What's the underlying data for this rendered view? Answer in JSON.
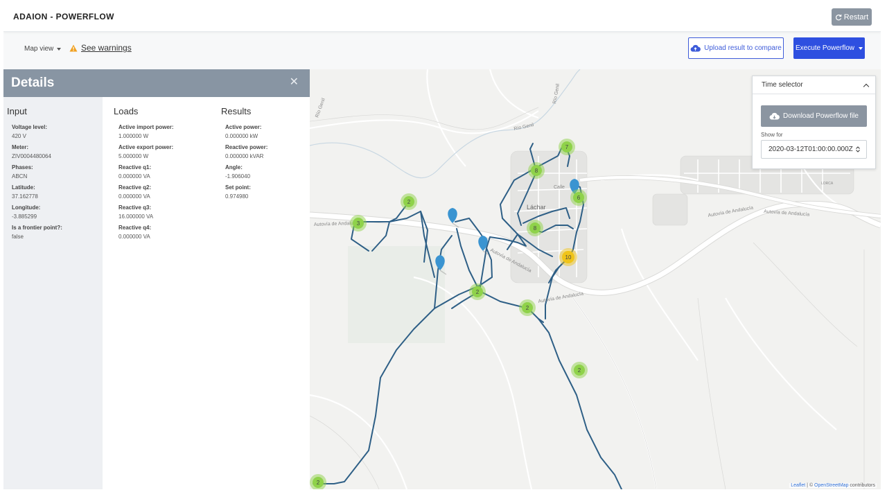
{
  "app": {
    "title": "ADAION - POWERFLOW",
    "restart_label": "Restart"
  },
  "toolbar": {
    "map_view_label": "Map view",
    "warnings_label": "See warnings",
    "upload_label": "Upload result to compare",
    "execute_label": "Execute Powerflow"
  },
  "details": {
    "title": "Details",
    "close_glyph": "✕",
    "input": {
      "heading": "Input",
      "fields": [
        {
          "label": "Voltage level:",
          "value": "420 V"
        },
        {
          "label": "Meter:",
          "value": "ZIV0004480064"
        },
        {
          "label": "Phases:",
          "value": "ABCN"
        },
        {
          "label": "Latitude:",
          "value": "37.162778"
        },
        {
          "label": "Longitude:",
          "value": "-3.885299"
        },
        {
          "label": "Is a frontier point?:",
          "value": "false"
        }
      ]
    },
    "loads": {
      "heading": "Loads",
      "fields": [
        {
          "label": "Active import power:",
          "value": "1.000000 W"
        },
        {
          "label": "Active export power:",
          "value": "5.000000 W"
        },
        {
          "label": "Reactive q1:",
          "value": "0.000000 VA"
        },
        {
          "label": "Reactive q2:",
          "value": "0.000000 VA"
        },
        {
          "label": "Reactive q3:",
          "value": "16.000000 VA"
        },
        {
          "label": "Reactive q4:",
          "value": "0.000000 VA"
        }
      ]
    },
    "results": {
      "heading": "Results",
      "fields": [
        {
          "label": "Active power:",
          "value": "0.000000 kW"
        },
        {
          "label": "Reactive power:",
          "value": "0.000000 kVAR"
        },
        {
          "label": "Angle:",
          "value": "-1.906040"
        },
        {
          "label": "Set point:",
          "value": "0.974980"
        }
      ]
    }
  },
  "time_selector": {
    "title": "Time selector",
    "download_label": "Download Powerflow file",
    "show_for_label": "Show for",
    "selected_time": "2020-03-12T01:00:00.000Z"
  },
  "map": {
    "town_label": "Láchar",
    "road_labels": [
      "Autovía de Andalucía",
      "Autovía de Andalucía",
      "Autovía de Andalucía",
      "Autovía de Andalucía",
      "Autovía de Andalucía"
    ],
    "river_labels": [
      "Río Genil",
      "Río Genil",
      "Río Genil"
    ],
    "street_label": "Calle",
    "lorca_label": "LORCA",
    "clusters": [
      {
        "count": "7",
        "color": "green"
      },
      {
        "count": "8",
        "color": "green"
      },
      {
        "count": "6",
        "color": "green"
      },
      {
        "count": "8",
        "color": "green"
      },
      {
        "count": "2",
        "color": "green"
      },
      {
        "count": "3",
        "color": "green"
      },
      {
        "count": "10",
        "color": "yellow"
      },
      {
        "count": "2",
        "color": "green"
      },
      {
        "count": "2",
        "color": "green"
      },
      {
        "count": "2",
        "color": "green"
      },
      {
        "count": "2",
        "color": "green"
      }
    ],
    "attribution": {
      "leaflet": "Leaflet",
      "separator": " | © ",
      "osm": "OpenStreetMap",
      "contributors": " contributors"
    },
    "colors": {
      "line": "#2e5f86",
      "pin": "#3a94d1",
      "cluster_green": "#8fd24a",
      "cluster_yellow": "#f0c419"
    }
  }
}
